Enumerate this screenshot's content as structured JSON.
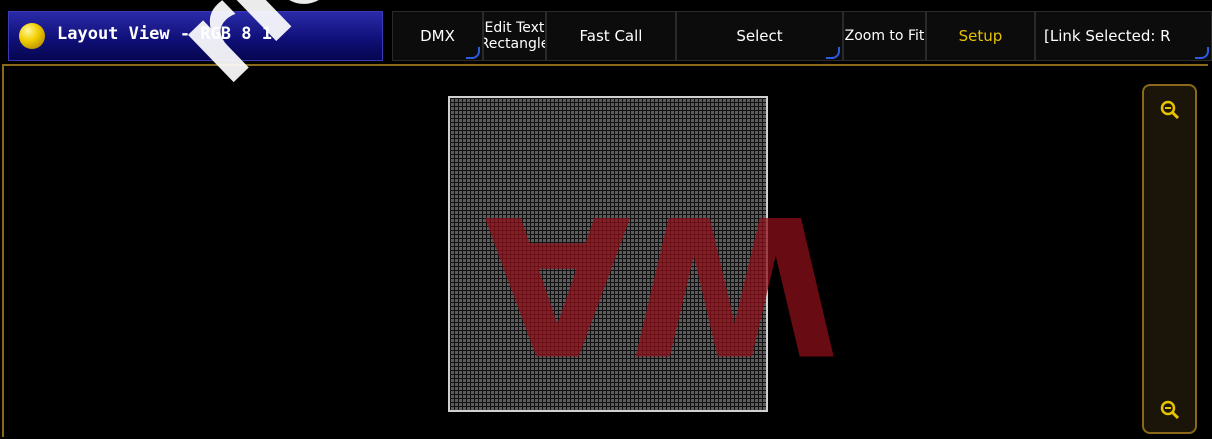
{
  "window": {
    "title": "Layout View - RGB 8 1"
  },
  "toolbar": {
    "buttons": [
      {
        "label": "DMX"
      },
      {
        "label": "Edit Text Rectangle"
      },
      {
        "label": "Fast Call"
      },
      {
        "label": "Select"
      },
      {
        "label": "Zoom to Fit"
      },
      {
        "label": "Setup"
      },
      {
        "label": "[Link Selected: R"
      }
    ]
  },
  "canvas": {
    "letters": [
      "A",
      "W"
    ]
  },
  "zoom_panel": {
    "zoom_in_icon": "magnifier-plus",
    "zoom_out_icon": "magnifier-plus"
  },
  "watermark": "rlosme"
}
